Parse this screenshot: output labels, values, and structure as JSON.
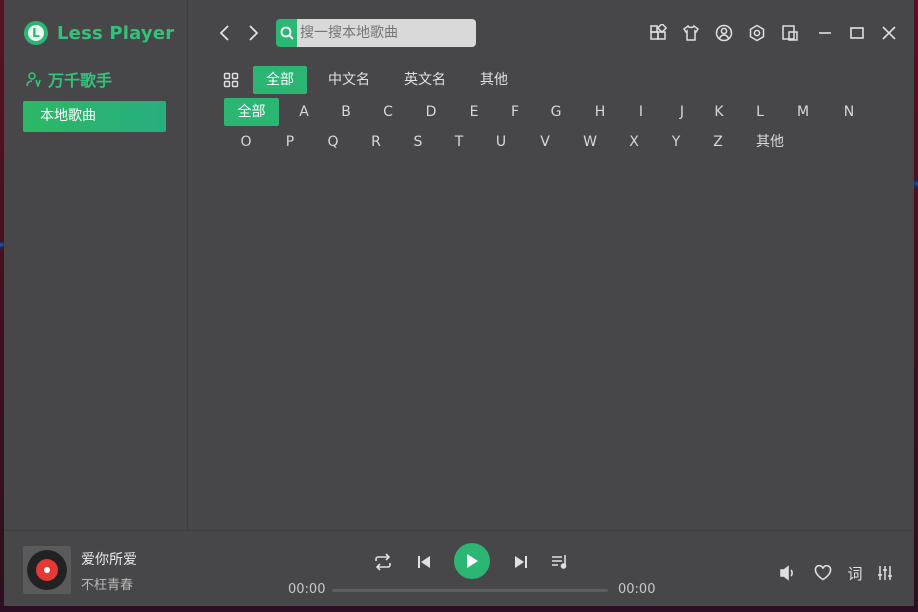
{
  "app": {
    "name": "Less Player",
    "logo_letter": "L",
    "accent": "#2bb673"
  },
  "sidebar": {
    "section_title": "万千歌手",
    "items": [
      {
        "label": "本地歌曲",
        "active": true
      }
    ]
  },
  "search": {
    "placeholder": "搜一搜本地歌曲"
  },
  "filter_tabs": [
    {
      "label": "全部",
      "active": true
    },
    {
      "label": "中文名",
      "active": false
    },
    {
      "label": "英文名",
      "active": false
    },
    {
      "label": "其他",
      "active": false
    }
  ],
  "letter_row1": [
    "全部",
    "A",
    "B",
    "C",
    "D",
    "E",
    "F",
    "G",
    "H",
    "I",
    "J",
    "K",
    "L",
    "M",
    "N"
  ],
  "letter_row2": [
    "O",
    "P",
    "Q",
    "R",
    "S",
    "T",
    "U",
    "V",
    "W",
    "X",
    "Y",
    "Z",
    "其他"
  ],
  "active_letter": "全部",
  "player": {
    "title": "爱你所爱",
    "artist": "不枉青春",
    "current_time": "00:00",
    "total_time": "00:00",
    "progress": 0,
    "lyrics_label": "词"
  },
  "icons": {
    "toolbar": [
      "apps-icon",
      "theme-shirt-icon",
      "user-icon",
      "settings-icon",
      "mini-mode-icon",
      "minimize-icon",
      "maximize-icon",
      "close-icon"
    ],
    "player": [
      "repeat-icon",
      "previous-icon",
      "play-icon",
      "next-icon",
      "playlist-icon",
      "volume-icon",
      "heart-icon",
      "equalizer-icon"
    ]
  }
}
